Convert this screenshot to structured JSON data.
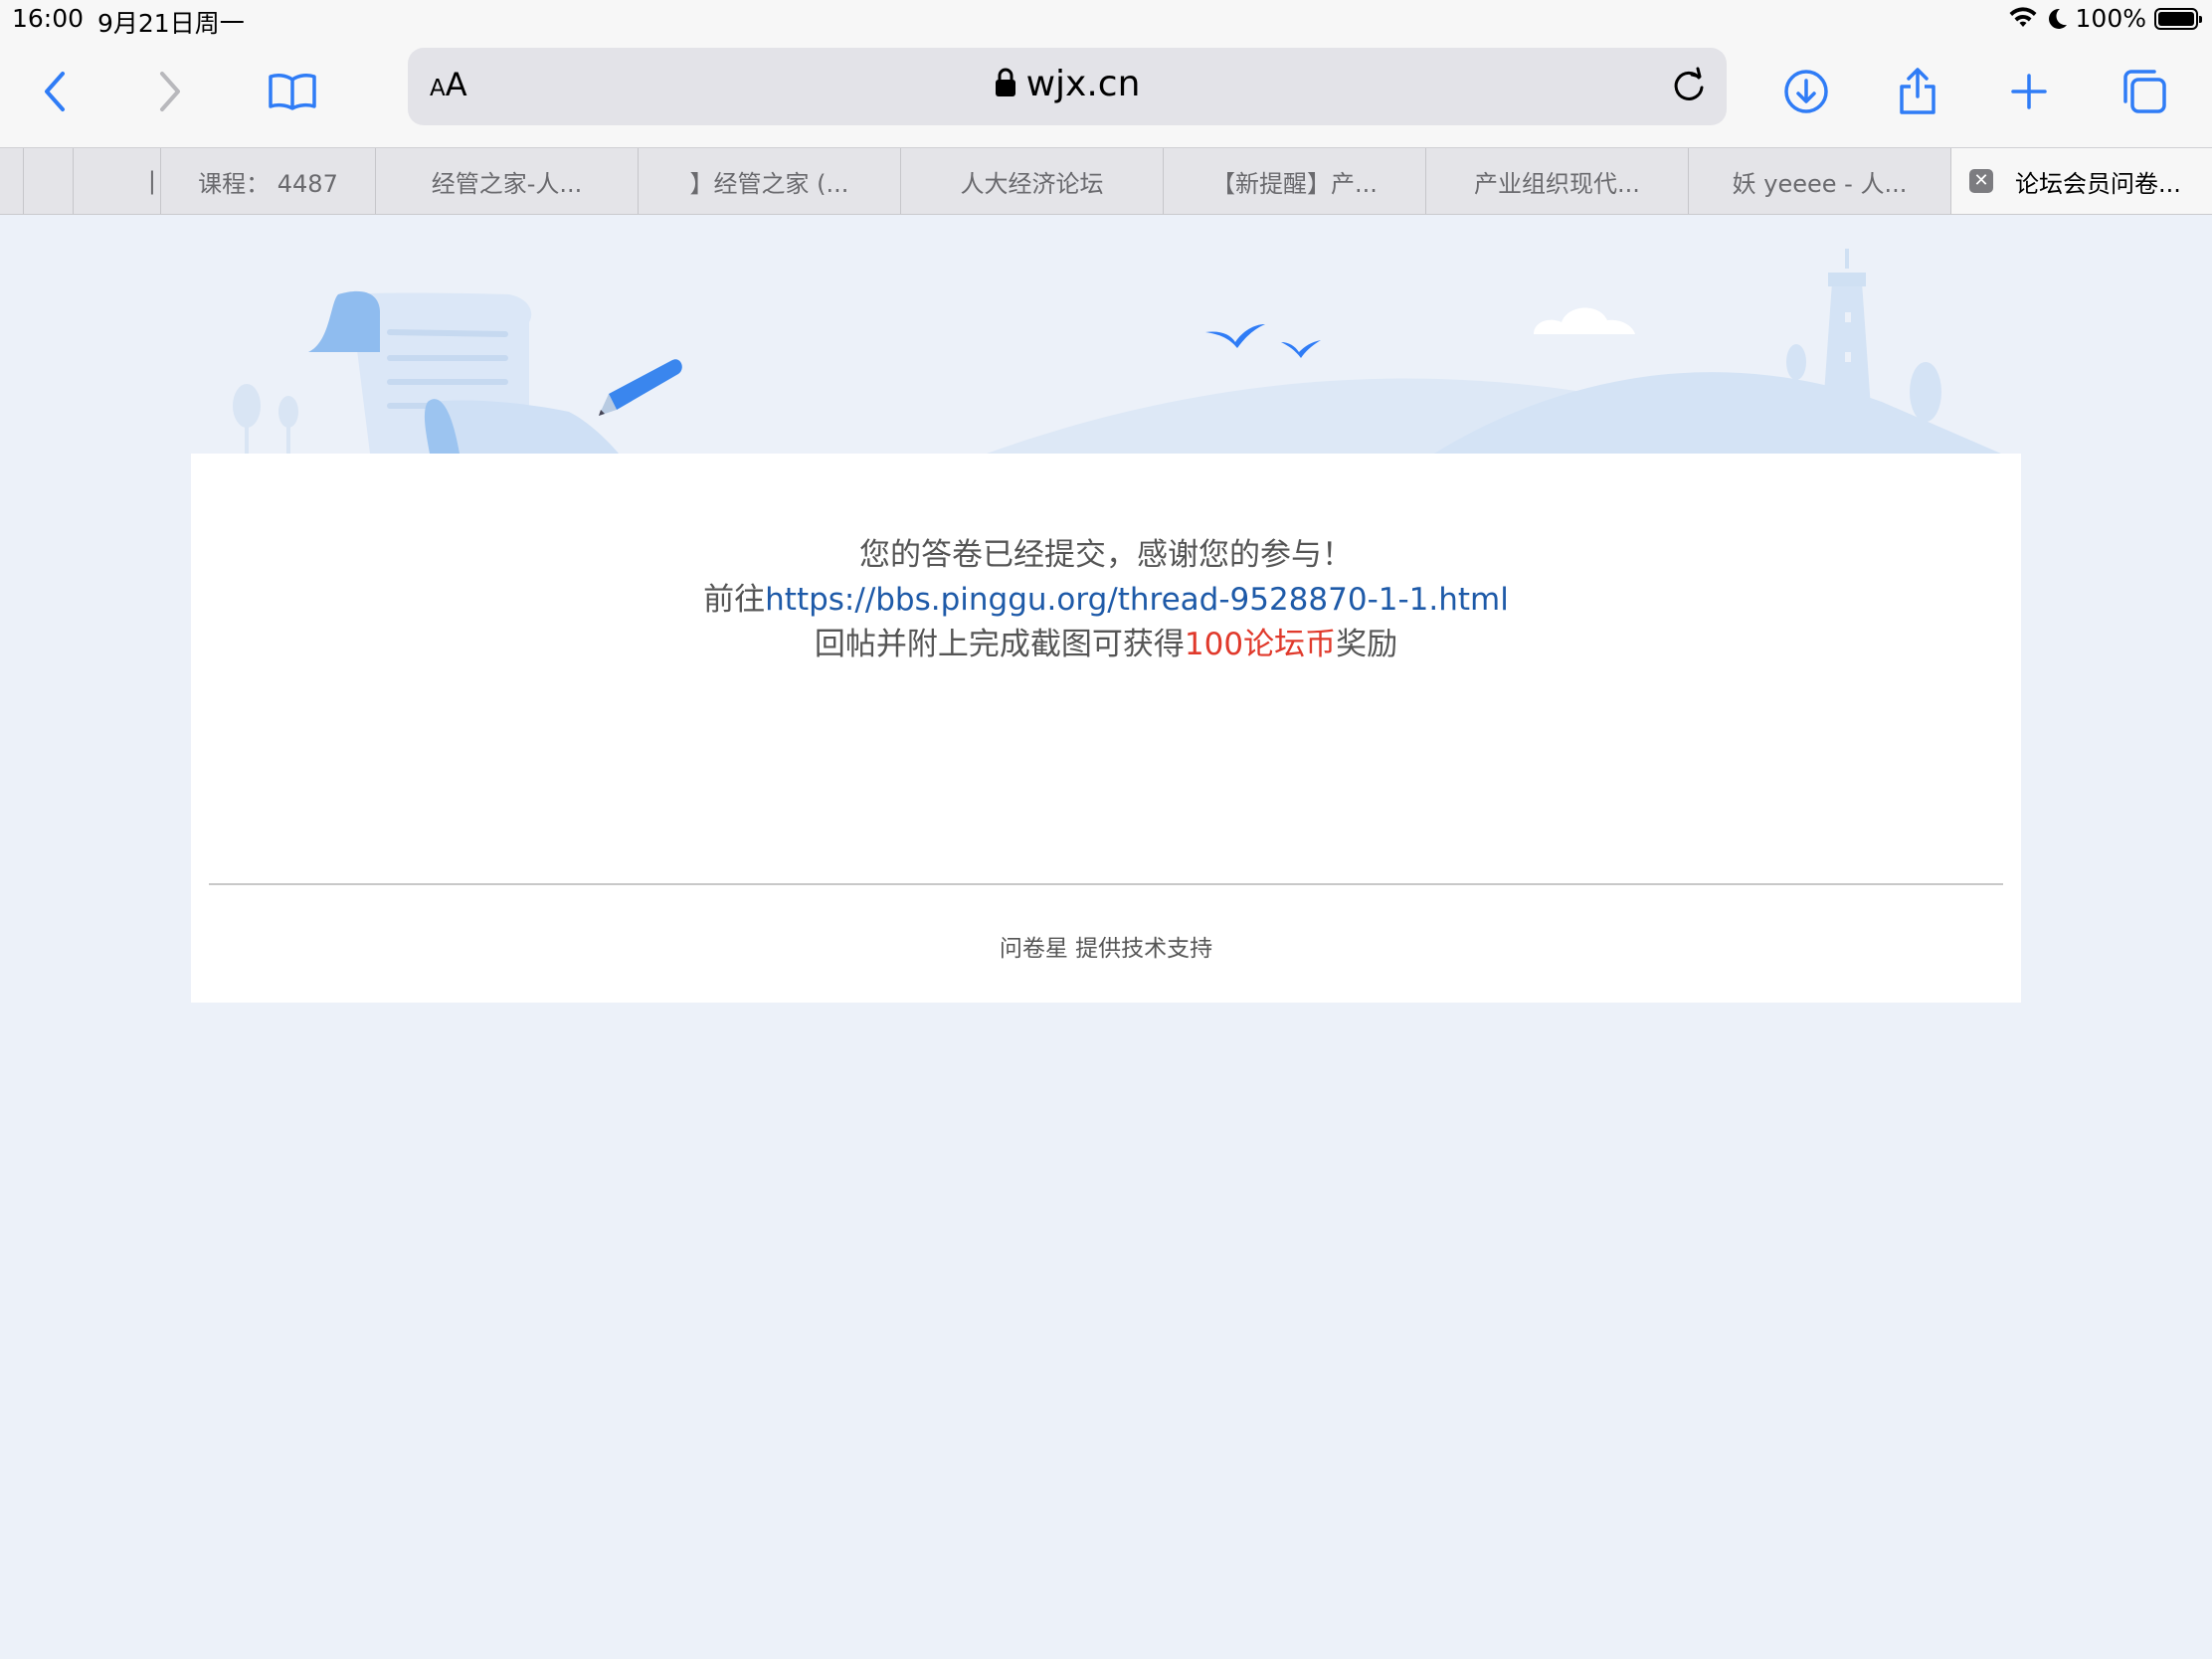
{
  "status_bar": {
    "time": "16:00",
    "date": "9月21日周一",
    "battery": "100%"
  },
  "toolbar": {
    "text_size_label_small": "A",
    "text_size_label_large": "A",
    "url": "wjx.cn"
  },
  "tabs": [
    {
      "label": "",
      "active": false
    },
    {
      "label": "",
      "active": false
    },
    {
      "label": "|",
      "active": false
    },
    {
      "label": "课程： 4487",
      "active": false
    },
    {
      "label": "经管之家-人...",
      "active": false
    },
    {
      "label": "】经管之家 (...",
      "active": false
    },
    {
      "label": "人大经济论坛",
      "active": false
    },
    {
      "label": "【新提醒】产...",
      "active": false
    },
    {
      "label": "产业组织现代...",
      "active": false
    },
    {
      "label": "妖 yeeee - 人...",
      "active": false
    },
    {
      "label": "论坛会员问卷...",
      "active": true
    }
  ],
  "page": {
    "message_line1": "您的答卷已经提交，感谢您的参与！",
    "message_line2_prefix": "前往",
    "message_line2_link": "https://bbs.pinggu.org/thread-9528870-1-1.html",
    "message_line3_prefix": "回帖并附上完成截图可获得",
    "message_line3_highlight": "100论坛币",
    "message_line3_suffix": "奖励",
    "footer": "问卷星 提供技术支持"
  },
  "colors": {
    "accent_blue": "#2f7cf6",
    "link_blue": "#1e5aa8",
    "highlight_red": "#e0392b",
    "page_background": "#ecf1f9"
  }
}
